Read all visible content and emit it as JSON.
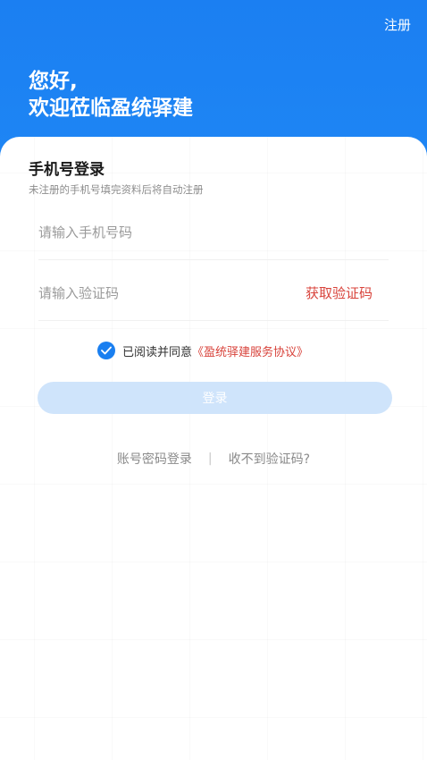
{
  "header": {
    "register_label": "注册",
    "greeting_line1": "您好,",
    "greeting_line2": "欢迎莅临盈统驿建"
  },
  "login": {
    "title": "手机号登录",
    "subtitle": "未注册的手机号填完资料后将自动注册",
    "phone_placeholder": "请输入手机号码",
    "code_placeholder": "请输入验证码",
    "get_code_label": "获取验证码",
    "agree_text": "已阅读并同意",
    "agreement_link": "《盈统驿建服务协议》",
    "agreement_checked": true,
    "login_button": "登录",
    "password_login_link": "账号密码登录",
    "separator": "|",
    "no_code_link": "收不到验证码?"
  },
  "colors": {
    "primary": "#1a7ff0",
    "accent_red": "#d8433b",
    "disabled_button": "#cfe4fb"
  }
}
